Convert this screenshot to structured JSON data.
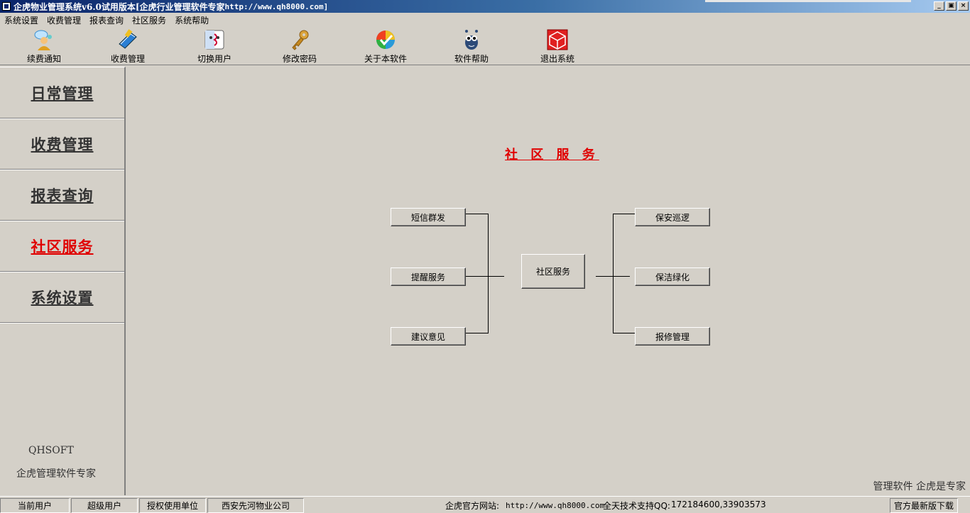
{
  "window": {
    "title": "企虎物业管理系统v6.0试用版本[企虎行业管理软件专家",
    "title_url": " http://www.qh8000.com]",
    "buttons": [
      "_",
      "▣",
      "×"
    ]
  },
  "menu": [
    "系统设置",
    "收费管理",
    "报表查询",
    "社区服务",
    "系统帮助"
  ],
  "toolbar": [
    {
      "label": "续费通知",
      "icon": "user-notify-icon"
    },
    {
      "label": "收费管理",
      "icon": "fee-book-icon"
    },
    {
      "label": "切换用户",
      "icon": "switch-user-icon"
    },
    {
      "label": "修改密码",
      "icon": "key-icon"
    },
    {
      "label": "关于本软件",
      "icon": "about-check-icon"
    },
    {
      "label": "软件帮助",
      "icon": "help-mascot-icon"
    },
    {
      "label": "退出系统",
      "icon": "exit-cube-icon"
    }
  ],
  "nav": {
    "items": [
      "日常管理",
      "收费管理",
      "报表查询",
      "社区服务",
      "系统设置"
    ],
    "active_index": 3,
    "brand_en": "QHSOFT",
    "brand_cn": "企虎管理软件专家"
  },
  "main": {
    "section_title": "社 区 服 务",
    "center": "社区服务",
    "left_buttons": [
      "短信群发",
      "提醒服务",
      "建议意见"
    ],
    "right_buttons": [
      "保安巡逻",
      "保洁绿化",
      "报修管理"
    ],
    "slogan": "管理软件 企虎是专家"
  },
  "status": {
    "current_user_label": "当前用户",
    "current_user": "超级用户",
    "licensee_label": "授权使用单位",
    "licensee": "西安先河物业公司",
    "website_label": "企虎官方网站:",
    "website": "http://www.qh8000.com",
    "support_label": "全天技术支持QQ:",
    "support_qq": "172184600,33903573",
    "download": "官方最新版下载"
  },
  "colors": {
    "face": "#d4d0c8",
    "accent": "#e00000",
    "title_bar": "#0a246a"
  }
}
